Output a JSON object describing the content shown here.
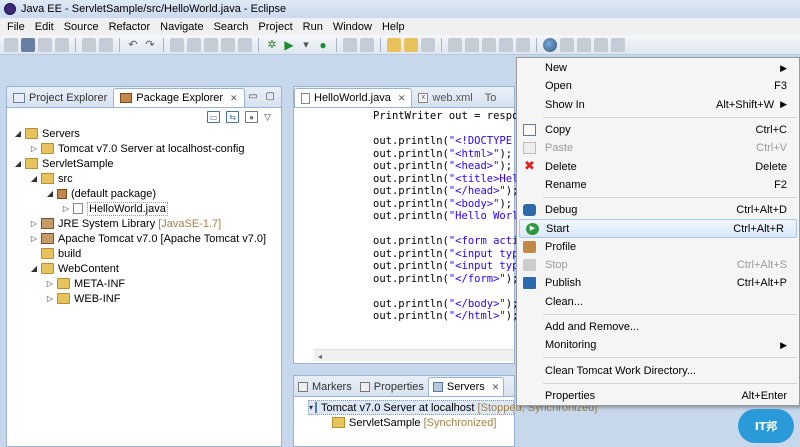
{
  "window": {
    "title": "Java EE - ServletSample/src/HelloWorld.java - Eclipse"
  },
  "menubar": [
    "File",
    "Edit",
    "Source",
    "Refactor",
    "Navigate",
    "Search",
    "Project",
    "Run",
    "Window",
    "Help"
  ],
  "left_pane": {
    "tabs": [
      {
        "label": "Project Explorer",
        "active": false
      },
      {
        "label": "Package Explorer",
        "active": true
      }
    ],
    "tree": [
      {
        "label": "Servers",
        "depth": 0,
        "twisty": "open",
        "icon": "folder-icon"
      },
      {
        "label": "Tomcat v7.0 Server at localhost-config",
        "depth": 1,
        "twisty": "closed",
        "icon": "folder-icon"
      },
      {
        "label": "ServletSample",
        "depth": 0,
        "twisty": "open",
        "icon": "project-icon"
      },
      {
        "label": "src",
        "depth": 1,
        "twisty": "open",
        "icon": "source-folder-icon"
      },
      {
        "label": "(default package)",
        "depth": 2,
        "twisty": "open",
        "icon": "package-icon"
      },
      {
        "label": "HelloWorld.java",
        "depth": 3,
        "twisty": "closed",
        "icon": "java-file-icon",
        "selected": true
      },
      {
        "label": "JRE System Library",
        "note": "[JavaSE-1.7]",
        "depth": 1,
        "twisty": "closed",
        "icon": "library-icon"
      },
      {
        "label": "Apache Tomcat v7.0 [Apache Tomcat v7.0]",
        "depth": 1,
        "twisty": "closed",
        "icon": "library-icon"
      },
      {
        "label": "build",
        "depth": 1,
        "twisty": "none",
        "icon": "folder-icon"
      },
      {
        "label": "WebContent",
        "depth": 1,
        "twisty": "open",
        "icon": "folder-icon"
      },
      {
        "label": "META-INF",
        "depth": 2,
        "twisty": "closed",
        "icon": "folder-icon"
      },
      {
        "label": "WEB-INF",
        "depth": 2,
        "twisty": "closed",
        "icon": "folder-icon"
      }
    ]
  },
  "editor": {
    "tabs": [
      {
        "label": "HelloWorld.java",
        "active": true
      },
      {
        "label": "web.xml",
        "active": false
      },
      {
        "label": "To",
        "active": false
      }
    ],
    "code_lines": [
      "PrintWriter out = respons",
      "",
      "out.println(\"<!DOCTYPE ht",
      "out.println(\"<html>\");",
      "out.println(\"<head>\");",
      "out.println(\"<title>Hello",
      "out.println(\"</head>\");",
      "out.println(\"<body>\");",
      "out.println(\"Hello World",
      "",
      "out.println(\"<form action",
      "out.println(\"<input type=",
      "out.println(\"<input type=",
      "out.println(\"</form>\");",
      "",
      "out.println(\"</body>\");",
      "out.println(\"</html>\");"
    ]
  },
  "bottom_pane": {
    "tabs": [
      {
        "label": "Markers",
        "active": false
      },
      {
        "label": "Properties",
        "active": false
      },
      {
        "label": "Servers",
        "active": true
      }
    ],
    "servers": [
      {
        "label": "Tomcat v7.0 Server at localhost",
        "note": "[Stopped, Synchronized]"
      },
      {
        "label": "ServletSample",
        "note": "[Synchronized]"
      }
    ]
  },
  "context_menu": {
    "groups": [
      [
        {
          "label": "New",
          "accel": "",
          "submenu": true
        },
        {
          "label": "Open",
          "accel": "F3"
        },
        {
          "label": "Show In",
          "accel": "Alt+Shift+W",
          "submenu": true
        }
      ],
      [
        {
          "label": "Copy",
          "accel": "Ctrl+C",
          "icon": "copy-icon"
        },
        {
          "label": "Paste",
          "accel": "Ctrl+V",
          "icon": "paste-icon",
          "disabled": true
        },
        {
          "label": "Delete",
          "accel": "Delete",
          "icon": "delete-icon"
        },
        {
          "label": "Rename",
          "accel": "F2"
        }
      ],
      [
        {
          "label": "Debug",
          "accel": "Ctrl+Alt+D",
          "icon": "debug-icon"
        },
        {
          "label": "Start",
          "accel": "Ctrl+Alt+R",
          "icon": "start-icon",
          "highlight": true
        },
        {
          "label": "Profile",
          "accel": "",
          "icon": "profile-icon"
        },
        {
          "label": "Stop",
          "accel": "Ctrl+Alt+S",
          "icon": "stop-icon",
          "disabled": true
        },
        {
          "label": "Publish",
          "accel": "Ctrl+Alt+P",
          "icon": "publish-icon"
        },
        {
          "label": "Clean...",
          "accel": ""
        }
      ],
      [
        {
          "label": "Add and Remove...",
          "accel": ""
        },
        {
          "label": "Monitoring",
          "accel": "",
          "submenu": true
        }
      ],
      [
        {
          "label": "Clean Tomcat Work Directory...",
          "accel": ""
        }
      ],
      [
        {
          "label": "Properties",
          "accel": "Alt+Enter"
        }
      ]
    ]
  },
  "colors": {
    "highlight": "#dbe8f7",
    "accent": "#2a9bd8",
    "string": "#2a00ff",
    "note": "#a08048"
  }
}
